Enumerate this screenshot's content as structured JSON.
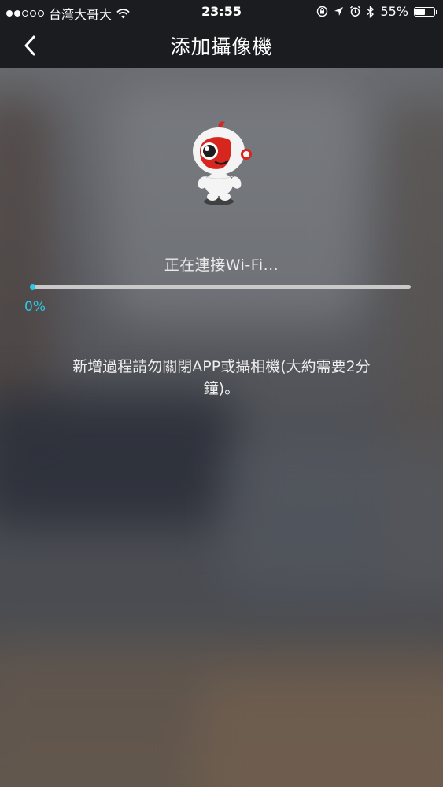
{
  "status_bar": {
    "carrier": "台湾大哥大",
    "signal_dots": [
      true,
      true,
      false,
      false,
      false
    ],
    "time": "23:55",
    "battery_percent": "55%",
    "battery_level": 0.55,
    "icons": [
      "wifi-icon",
      "rotation-lock-icon",
      "location-arrow-icon",
      "alarm-icon",
      "bluetooth-icon",
      "battery-icon"
    ]
  },
  "nav": {
    "back_icon": "chevron-left-icon",
    "title": "添加攝像機"
  },
  "main": {
    "mascot": "robot-mascot",
    "status_text": "正在連接Wi-Fi...",
    "progress_value": 0,
    "progress_label": "0%",
    "notice_line1": "新增過程請勿關閉APP或攝相機(大約需要2分",
    "notice_line2": "鐘)。"
  },
  "colors": {
    "accent": "#2fc7e3",
    "nav_background": "#1b1c20",
    "mascot_red": "#d7261e"
  }
}
